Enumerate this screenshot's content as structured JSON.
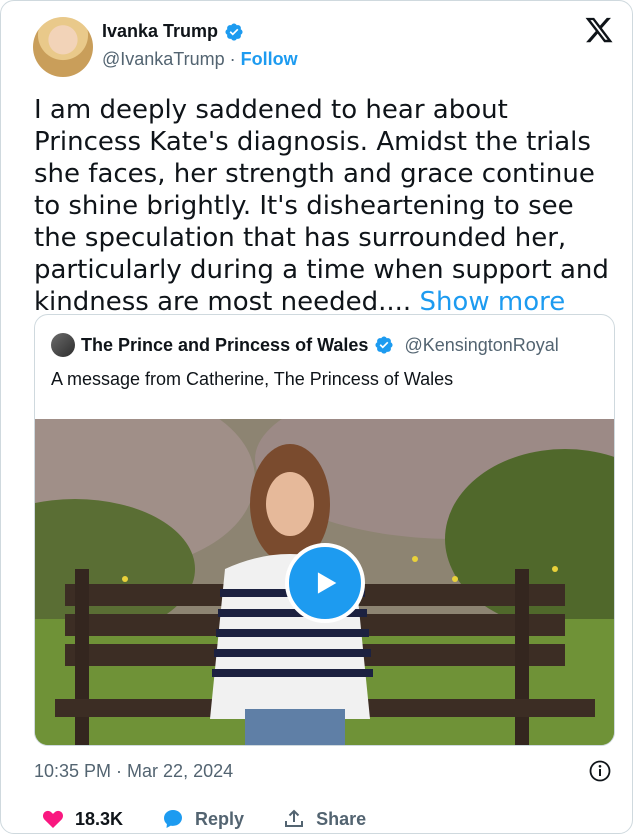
{
  "author": {
    "name": "Ivanka Trump",
    "handle": "@IvankaTrump",
    "separator": " · ",
    "follow_label": "Follow"
  },
  "tweet": {
    "text": "I am deeply saddened to hear about Princess Kate's diagnosis. Amidst the trials she faces, her strength and grace continue to shine brightly. It's disheartening to see the speculation that has surrounded her, particularly during a time when support and kindness are most needed.... ",
    "show_more_label": "Show more"
  },
  "quoted": {
    "name": "The Prince and Princess of Wales",
    "handle": "@KensingtonRoyal",
    "text": "A message from Catherine, The Princess of Wales"
  },
  "footer": {
    "timestamp": "10:35 PM · Mar 22, 2024",
    "likes_count": "18.3K",
    "reply_label": "Reply",
    "share_label": "Share"
  },
  "colors": {
    "accent": "#1d9bf0",
    "like": "#f91880",
    "muted": "#536471"
  }
}
